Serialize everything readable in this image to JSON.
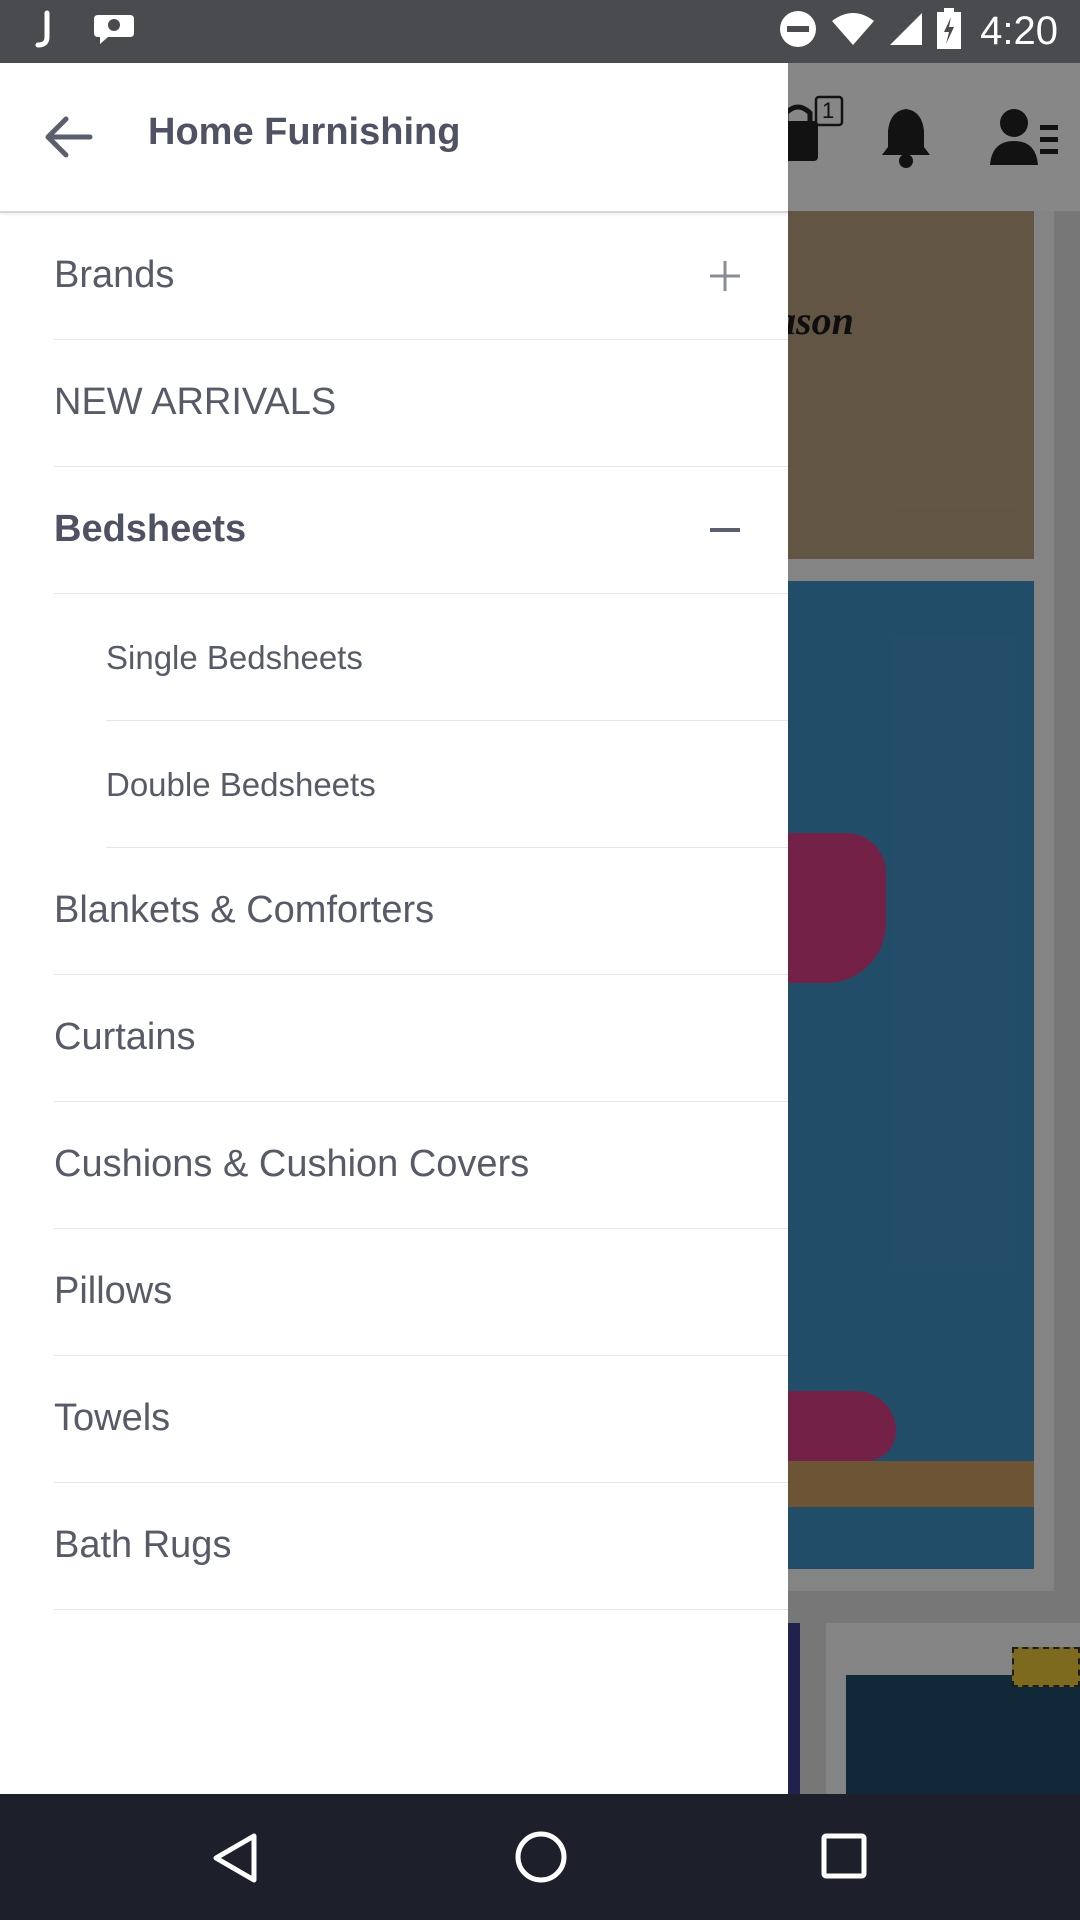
{
  "status_bar": {
    "time": "4:20",
    "left_icons": [
      "j-app-icon",
      "chat-bubble-icon"
    ],
    "right_icons": [
      "do-not-disturb-icon",
      "wifi-icon",
      "signal-icon",
      "battery-charging-icon"
    ]
  },
  "drawer": {
    "title": "Home Furnishing",
    "back_icon": "arrow-left-icon",
    "items": [
      {
        "label": "Brands",
        "toggle": "plus-icon"
      },
      {
        "label": "NEW ARRIVALS"
      },
      {
        "label": "Bedsheets",
        "toggle": "minus-icon",
        "expanded": true
      },
      {
        "label": "Single Bedsheets",
        "sub": true
      },
      {
        "label": "Double Bedsheets",
        "sub": true
      },
      {
        "label": "Blankets & Comforters"
      },
      {
        "label": "Curtains"
      },
      {
        "label": "Cushions & Cushion Covers"
      },
      {
        "label": "Pillows"
      },
      {
        "label": "Towels"
      },
      {
        "label": "Bath Rugs"
      }
    ]
  },
  "background_app": {
    "cart_badge": "1",
    "header_icons": [
      "cart-icon",
      "bell-icon",
      "account-menu-icon"
    ],
    "visible_text": "ason"
  },
  "nav_bar": {
    "icons": [
      "back-triangle-icon",
      "home-circle-icon",
      "recents-square-icon"
    ]
  },
  "colors": {
    "status_bar": "#4a4b4f",
    "nav_bar": "#1d1f2b",
    "drawer_text": "#575a67",
    "drawer_title": "#4e5263",
    "divider": "#e6e6e6"
  }
}
